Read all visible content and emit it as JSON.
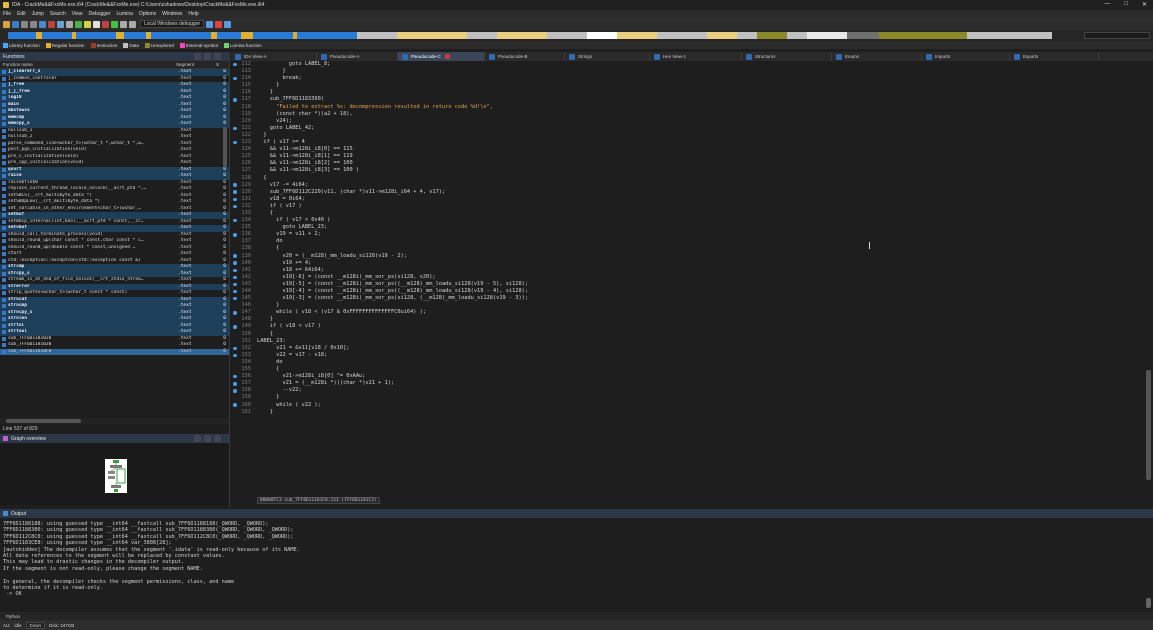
{
  "window": {
    "title": "IDA - CrackMe&&FxxMe.exe.i64 (CrackMe&&FxxMe.exe) C:\\Users\\zshadows\\Desktop\\CrackMe&&FxxMe.exe.i64",
    "controls": [
      "—",
      "□",
      "✕"
    ]
  },
  "menu": [
    "File",
    "Edit",
    "Jump",
    "Search",
    "View",
    "Debugger",
    "Lumina",
    "Options",
    "Windows",
    "Help"
  ],
  "toolbar": {
    "debugger_label": "Local Windows debugger"
  },
  "legend": [
    {
      "label": "Library function",
      "color": "#4aa3ff"
    },
    {
      "label": "Regular function",
      "color": "#e0b030"
    },
    {
      "label": "Instruction",
      "color": "#9a3a2a"
    },
    {
      "label": "Data",
      "color": "#c0c0c0"
    },
    {
      "label": "Unexplored",
      "color": "#8a8a2a"
    },
    {
      "label": "External symbol",
      "color": "#ff40c0"
    },
    {
      "label": "Lumina function",
      "color": "#70d070"
    }
  ],
  "functions_panel": {
    "title": "Functions",
    "columns": {
      "name": "Function name",
      "segment": "Segment",
      "s": "S"
    },
    "rows": [
      {
        "name": "j_clearerr_s",
        "seg": ".text",
        "n": "0",
        "kind": "lib"
      },
      {
        "name": "j_common_control87",
        "seg": ".text",
        "n": "0",
        "kind": "reg"
      },
      {
        "name": "j_free",
        "seg": ".text",
        "n": "0",
        "kind": "lib"
      },
      {
        "name": "j_j_free",
        "seg": ".text",
        "n": "0",
        "kind": "lib"
      },
      {
        "name": "log10",
        "seg": ".text",
        "n": "0",
        "kind": "lib"
      },
      {
        "name": "main",
        "seg": ".text",
        "n": "0",
        "kind": "lib"
      },
      {
        "name": "mbstowcs",
        "seg": ".text",
        "n": "0",
        "kind": "lib"
      },
      {
        "name": "memcmp",
        "seg": ".text",
        "n": "0",
        "kind": "lib"
      },
      {
        "name": "memcpy_s",
        "seg": ".text",
        "n": "0",
        "kind": "lib"
      },
      {
        "name": "nullsub_1",
        "seg": ".text",
        "n": "0",
        "kind": "reg"
      },
      {
        "name": "nullsub_2",
        "seg": ".text",
        "n": "0",
        "kind": "reg"
      },
      {
        "name": "parse_command_line<wchar_t>(wchar_t *,wchar_t *,w…",
        "seg": ".text",
        "n": "0",
        "kind": "reg"
      },
      {
        "name": "post_pgo_initialization(void)",
        "seg": ".text",
        "n": "0",
        "kind": "reg"
      },
      {
        "name": "pre_c_initialization(void)",
        "seg": ".text",
        "n": "0",
        "kind": "reg"
      },
      {
        "name": "pre_cpp_initialization(void)",
        "seg": ".text",
        "n": "0",
        "kind": "reg"
      },
      {
        "name": "qsort",
        "seg": ".text",
        "n": "0",
        "kind": "lib"
      },
      {
        "name": "raise",
        "seg": ".text",
        "n": "0",
        "kind": "lib"
      },
      {
        "name": "raise$fin$0",
        "seg": ".text",
        "n": "0",
        "kind": "reg"
      },
      {
        "name": "replace_current_thread_locale_nolock(__acrt_ptd *,…",
        "seg": ".text",
        "n": "0",
        "kind": "reg"
      },
      {
        "name": "setSBCS(__crt_multibyte_data *)",
        "seg": ".text",
        "n": "0",
        "kind": "reg"
      },
      {
        "name": "setSBUpLow(__crt_multibyte_data *)",
        "seg": ".text",
        "n": "0",
        "kind": "reg"
      },
      {
        "name": "set_variable_in_other_environment<char_t>(wchar_…",
        "seg": ".text",
        "n": "0",
        "kind": "reg"
      },
      {
        "name": "setbuf",
        "seg": ".text",
        "n": "0",
        "kind": "lib"
      },
      {
        "name": "setmbcp_internal(int,bool,__acrt_ptd * const,__cr…",
        "seg": ".text",
        "n": "0",
        "kind": "reg"
      },
      {
        "name": "setvbuf",
        "seg": ".text",
        "n": "0",
        "kind": "lib"
      },
      {
        "name": "should_call_terminate_process(void)",
        "seg": ".text",
        "n": "0",
        "kind": "reg"
      },
      {
        "name": "should_round_up(char const * const,char const * c…",
        "seg": ".text",
        "n": "0",
        "kind": "reg"
      },
      {
        "name": "should_round_up(double const * const,unsigned …",
        "seg": ".text",
        "n": "0",
        "kind": "reg"
      },
      {
        "name": "start",
        "seg": ".text",
        "n": "0",
        "kind": "reg"
      },
      {
        "name": "std::exception::exception(std::exception const &)",
        "seg": ".text",
        "n": "0",
        "kind": "reg"
      },
      {
        "name": "strcmp",
        "seg": ".text",
        "n": "0",
        "kind": "lib"
      },
      {
        "name": "strcpy_s",
        "seg": ".text",
        "n": "0",
        "kind": "lib"
      },
      {
        "name": "stream_is_at_end_of_file_nolock(__crt_stdio_strea…",
        "seg": ".text",
        "n": "0",
        "kind": "reg"
      },
      {
        "name": "strerror",
        "seg": ".text",
        "n": "0",
        "kind": "lib"
      },
      {
        "name": "strip_quotes<wchar_t>(wchar_t const * const)",
        "seg": ".text",
        "n": "0",
        "kind": "reg"
      },
      {
        "name": "strncat",
        "seg": ".text",
        "n": "0",
        "kind": "lib"
      },
      {
        "name": "strncmp",
        "seg": ".text",
        "n": "0",
        "kind": "lib"
      },
      {
        "name": "strncpy_s",
        "seg": ".text",
        "n": "0",
        "kind": "lib"
      },
      {
        "name": "strnlen",
        "seg": ".text",
        "n": "0",
        "kind": "lib"
      },
      {
        "name": "strtol",
        "seg": ".text",
        "n": "0",
        "kind": "lib"
      },
      {
        "name": "strtoul",
        "seg": ".text",
        "n": "0",
        "kind": "lib"
      },
      {
        "name": "sub_7FF6D1181020",
        "seg": ".text",
        "n": "0",
        "kind": "reg"
      },
      {
        "name": "sub_7FF6D1181030",
        "seg": ".text",
        "n": "0",
        "kind": "reg"
      },
      {
        "name": "sub_7FF6D11810F0",
        "seg": ".text",
        "n": "0",
        "kind": "sel"
      }
    ],
    "line_count": "Line 537 of 829"
  },
  "graph_panel": {
    "title": "Graph overview"
  },
  "tabs": [
    {
      "label": "IDA View-A",
      "active": false
    },
    {
      "label": "Pseudocode-A",
      "active": false
    },
    {
      "label": "Pseudocode-C",
      "active": true
    },
    {
      "label": "Pseudocode-B",
      "active": false
    },
    {
      "label": "Strings",
      "active": false
    },
    {
      "label": "Hex View-1",
      "active": false
    },
    {
      "label": "Structures",
      "active": false
    },
    {
      "label": "Enums",
      "active": false
    },
    {
      "label": "Imports",
      "active": false
    },
    {
      "label": "Exports",
      "active": false
    }
  ],
  "code": [
    {
      "n": "112",
      "dot": true,
      "t": "          goto LABEL_8;",
      "s": false
    },
    {
      "n": "113",
      "dot": false,
      "t": "        }",
      "s": false
    },
    {
      "n": "114",
      "dot": true,
      "t": "        break;",
      "s": false
    },
    {
      "n": "115",
      "dot": false,
      "t": "      }",
      "s": false
    },
    {
      "n": "116",
      "dot": false,
      "t": "    }",
      "s": false
    },
    {
      "n": "117",
      "dot": true,
      "t": "    sub_7FF6D1183390(",
      "s": false
    },
    {
      "n": "118",
      "dot": false,
      "t": "      \"Failed to extract %s: decompression resulted in return code %d!\\n\",",
      "s": true
    },
    {
      "n": "119",
      "dot": false,
      "t": "      (const char *)(a2 + 18),",
      "s": false
    },
    {
      "n": "120",
      "dot": false,
      "t": "      v24);",
      "s": false
    },
    {
      "n": "121",
      "dot": true,
      "t": "    goto LABEL_42;",
      "s": false
    },
    {
      "n": "122",
      "dot": false,
      "t": "  }",
      "s": false
    },
    {
      "n": "123",
      "dot": true,
      "t": "  if ( v17 >= 4",
      "s": false
    },
    {
      "n": "124",
      "dot": false,
      "t": "    && v11->m128i_i8[0] == 115",
      "s": false
    },
    {
      "n": "125",
      "dot": false,
      "t": "    && v11->m128i_i8[1] == 119",
      "s": false
    },
    {
      "n": "126",
      "dot": false,
      "t": "    && v11->m128i_i8[2] == 100",
      "s": false
    },
    {
      "n": "127",
      "dot": false,
      "t": "    && v11->m128i_i8[3] == 100 )",
      "s": false
    },
    {
      "n": "128",
      "dot": false,
      "t": "  {",
      "s": false
    },
    {
      "n": "129",
      "dot": true,
      "t": "    v17 -= 4i64;",
      "s": false
    },
    {
      "n": "130",
      "dot": true,
      "t": "    sub_7FF6D112C220(v11, (char *)v11->m128i_i64 + 4, v17);",
      "s": false
    },
    {
      "n": "131",
      "dot": true,
      "t": "    v18 = 0i64;",
      "s": false
    },
    {
      "n": "132",
      "dot": true,
      "t": "    if ( v17 )",
      "s": false
    },
    {
      "n": "133",
      "dot": false,
      "t": "    {",
      "s": false
    },
    {
      "n": "134",
      "dot": true,
      "t": "      if ( v17 < 0x40 )",
      "s": false
    },
    {
      "n": "135",
      "dot": false,
      "t": "        goto LABEL_23;",
      "s": false
    },
    {
      "n": "136",
      "dot": true,
      "t": "      v19 = v11 + 2;",
      "s": false
    },
    {
      "n": "137",
      "dot": false,
      "t": "      do",
      "s": false
    },
    {
      "n": "138",
      "dot": false,
      "t": "      {",
      "s": false
    },
    {
      "n": "139",
      "dot": true,
      "t": "        v20 = (__m128)_mm_loadu_si128(v19 - 2);",
      "s": false
    },
    {
      "n": "140",
      "dot": true,
      "t": "        v19 += 4;",
      "s": false
    },
    {
      "n": "141",
      "dot": true,
      "t": "        v18 += 64i64;",
      "s": false
    },
    {
      "n": "142",
      "dot": true,
      "t": "        v19[-6] = (const __m128i)_mm_xor_ps(si128, v20);",
      "s": false
    },
    {
      "n": "143",
      "dot": true,
      "t": "        v19[-5] = (const __m128i)_mm_xor_ps((__m128)_mm_loadu_si128(v19 - 5), si128);",
      "s": false
    },
    {
      "n": "144",
      "dot": true,
      "t": "        v19[-4] = (const __m128i)_mm_xor_ps((__m128)_mm_loadu_si128(v19 - 4), si128);",
      "s": false
    },
    {
      "n": "145",
      "dot": true,
      "t": "        v19[-3] = (const __m128i)_mm_xor_ps(si128, (__m128)_mm_loadu_si128(v19 - 3));",
      "s": false
    },
    {
      "n": "146",
      "dot": false,
      "t": "      }",
      "s": false
    },
    {
      "n": "147",
      "dot": true,
      "t": "      while ( v18 < (v17 & 0xFFFFFFFFFFFFFFC0ui64) );",
      "s": false
    },
    {
      "n": "148",
      "dot": false,
      "t": "    }",
      "s": false
    },
    {
      "n": "149",
      "dot": true,
      "t": "    if ( v18 < v17 )",
      "s": false
    },
    {
      "n": "150",
      "dot": false,
      "t": "    {",
      "s": false
    },
    {
      "n": "151",
      "dot": false,
      "t": "LABEL_23:",
      "s": false
    },
    {
      "n": "152",
      "dot": true,
      "t": "      v21 = &v11[v18 / 0x10];",
      "s": false
    },
    {
      "n": "153",
      "dot": true,
      "t": "      v22 = v17 - v18;",
      "s": false
    },
    {
      "n": "154",
      "dot": false,
      "t": "      do",
      "s": false
    },
    {
      "n": "155",
      "dot": false,
      "t": "      {",
      "s": false
    },
    {
      "n": "156",
      "dot": true,
      "t": "        v21->m128i_i8[0] ^= 0xAAu;",
      "s": false
    },
    {
      "n": "157",
      "dot": true,
      "t": "        v21 = (__m128i *)((char *)v21 + 1);",
      "s": false
    },
    {
      "n": "158",
      "dot": true,
      "t": "        --v22;",
      "s": false
    },
    {
      "n": "159",
      "dot": false,
      "t": "      }",
      "s": false
    },
    {
      "n": "160",
      "dot": true,
      "t": "      while ( v22 );",
      "s": false
    },
    {
      "n": "161",
      "dot": false,
      "t": "    }",
      "s": false
    }
  ],
  "code_status": "00000TC3 sub_7FF6D11181F0:133 (7FF6D1181C3)",
  "output": {
    "title": "Output",
    "lines": [
      "7FF6D1188188: using guessed type __int64 __fastcall sub_7FF6D1188188(_QWORD, _QWORD);",
      "7FF6D1188380: using guessed type __int64 __fastcall sub_7FF6D1188380(_QWORD, _QWORD, _QWORD);",
      "7FF6D112C8C0: using guessed type __int64 __fastcall sub_7FF6D112C8C0(_QWORD, _QWORD, _QWORD);",
      "7FF6D1183CE8: using guessed type __int64 var_3808[28];",
      "[autohidden] The decompiler assumes that the segment '.idata' is read-only because of its NAME.",
      "All data references to the segment will be replaced by constant values.",
      "This may lead to drastic changes in the decompiler output.",
      "If the segment is not read-only, please change the segment NAME.",
      "",
      "In general, the decompiler checks the segment permissions, class, and name",
      "to determine if it is read-only.",
      " -> OK"
    ],
    "python_tab": "Python"
  },
  "status": {
    "au": "AU:",
    "state": "idle",
    "direction": "Down",
    "disk": "Disk: 347GB"
  }
}
